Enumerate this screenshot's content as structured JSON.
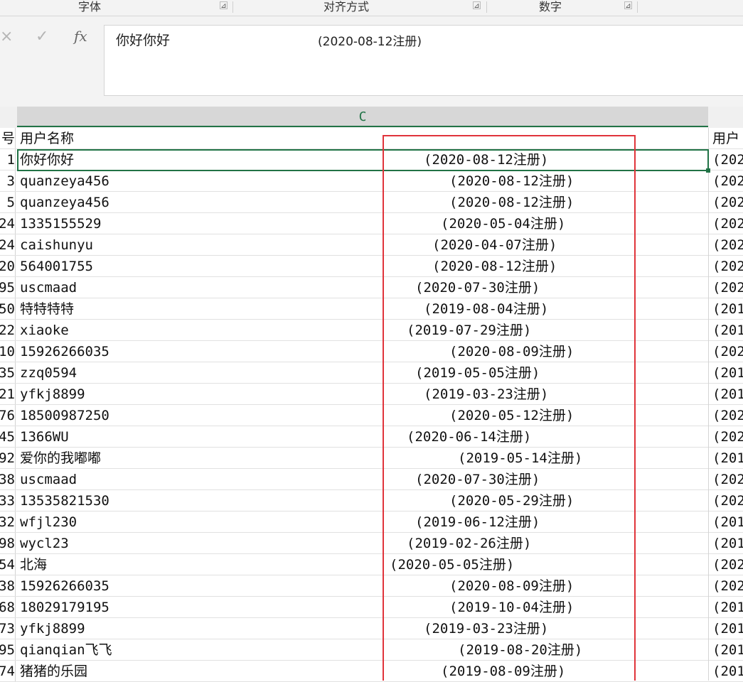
{
  "ribbon": {
    "groups": [
      {
        "label": "字体",
        "launcher": "⊿"
      },
      {
        "label": "对齐方式",
        "launcher": "⊿"
      },
      {
        "label": "数字",
        "launcher": "⊿"
      }
    ]
  },
  "formula_bar": {
    "cancel_icon": "×",
    "enter_icon": "✓",
    "fx_icon": "fx",
    "value_name": "你好你好",
    "value_date": "(2020-08-12注册)"
  },
  "column_header": {
    "label": "C"
  },
  "header_row": {
    "rownum": "号",
    "name": "用户名称",
    "next": "用户"
  },
  "rows": [
    {
      "rownum": "1",
      "name": "你好你好",
      "date": "(2020-08-12注册)",
      "next": "(202",
      "offset": 56
    },
    {
      "rownum": "3",
      "name": "quanzeya456",
      "date": "(2020-08-12注册)",
      "next": "(202",
      "offset": 92
    },
    {
      "rownum": "5",
      "name": "quanzeya456",
      "date": "(2020-08-12注册)",
      "next": "(202",
      "offset": 92
    },
    {
      "rownum": "24",
      "name": "1335155529",
      "date": "(2020-05-04注册)",
      "next": "(202",
      "offset": 80
    },
    {
      "rownum": "24",
      "name": "caishunyu",
      "date": "(2020-04-07注册)",
      "next": "(202",
      "offset": 68
    },
    {
      "rownum": "20",
      "name": "564001755",
      "date": "(2020-08-12注册)",
      "next": "(202",
      "offset": 68
    },
    {
      "rownum": "95",
      "name": "uscmaad",
      "date": "(2020-07-30注册)",
      "next": "(202",
      "offset": 44
    },
    {
      "rownum": "50",
      "name": "特特特特",
      "date": "(2019-08-04注册)",
      "next": "(201",
      "offset": 56
    },
    {
      "rownum": "22",
      "name": "xiaoke",
      "date": "(2019-07-29注册)",
      "next": "(201",
      "offset": 32
    },
    {
      "rownum": "10",
      "name": "15926266035",
      "date": "(2020-08-09注册)",
      "next": "(202",
      "offset": 92
    },
    {
      "rownum": "35",
      "name": "zzq0594",
      "date": "(2019-05-05注册)",
      "next": "(201",
      "offset": 44
    },
    {
      "rownum": "21",
      "name": "yfkj8899",
      "date": "(2019-03-23注册)",
      "next": "(201",
      "offset": 56
    },
    {
      "rownum": "76",
      "name": "18500987250",
      "date": "(2020-05-12注册)",
      "next": "(202",
      "offset": 92
    },
    {
      "rownum": "45",
      "name": "1366WU",
      "date": "(2020-06-14注册)",
      "next": "(202",
      "offset": 32
    },
    {
      "rownum": "92",
      "name": "爱你的我嘟嘟",
      "date": "(2019-05-14注册)",
      "next": "(201",
      "offset": 104
    },
    {
      "rownum": "38",
      "name": "uscmaad",
      "date": "(2020-07-30注册)",
      "next": "(202",
      "offset": 44
    },
    {
      "rownum": "33",
      "name": "13535821530",
      "date": "(2020-05-29注册)",
      "next": "(202",
      "offset": 92
    },
    {
      "rownum": "32",
      "name": "wfjl230",
      "date": "(2019-06-12注册)",
      "next": "(201",
      "offset": 44
    },
    {
      "rownum": "98",
      "name": "wycl23",
      "date": "(2019-02-26注册)",
      "next": "(201",
      "offset": 32
    },
    {
      "rownum": "54",
      "name": "北海",
      "date": "(2020-05-05注册)",
      "next": "(202",
      "offset": 8
    },
    {
      "rownum": "38",
      "name": "15926266035",
      "date": "(2020-08-09注册)",
      "next": "(202",
      "offset": 92
    },
    {
      "rownum": "68",
      "name": "18029179195",
      "date": "(2019-10-04注册)",
      "next": "(201",
      "offset": 92
    },
    {
      "rownum": "73",
      "name": "yfkj8899",
      "date": "(2019-03-23注册)",
      "next": "(201",
      "offset": 56
    },
    {
      "rownum": "95",
      "name": "qianqian飞飞",
      "date": "(2019-08-20注册)",
      "next": "(201",
      "offset": 104
    },
    {
      "rownum": "74",
      "name": "猪猪的乐园",
      "date": "(2019-08-09注册)",
      "next": "(201",
      "offset": 80
    }
  ],
  "colors": {
    "selection": "#217346",
    "annotation_box": "#e0343b"
  }
}
